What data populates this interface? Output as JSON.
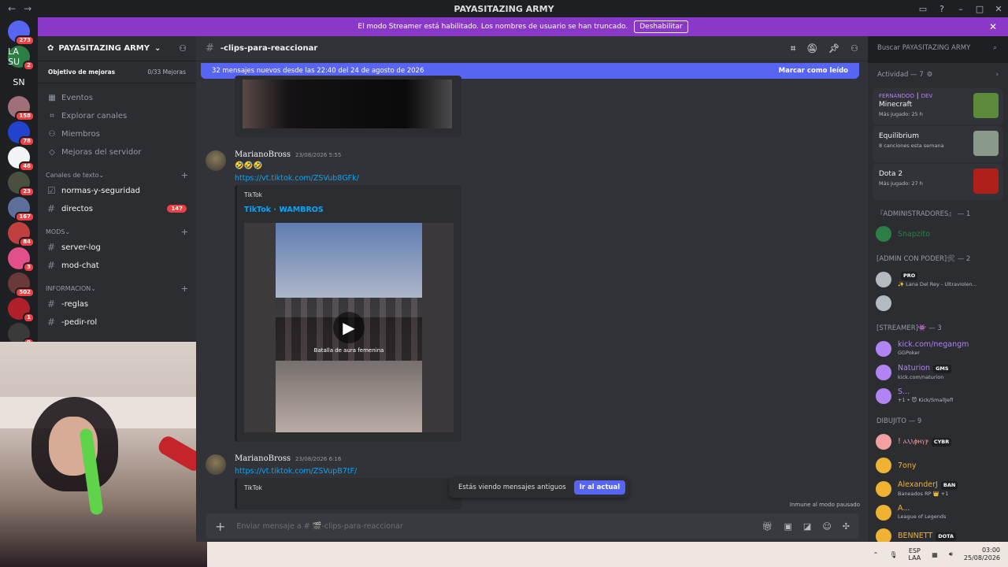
{
  "window": {
    "title": "PAYASITAZING ARMY"
  },
  "banner": {
    "text": "El modo Streamer está habilitado. Los nombres de usuario se han truncado.",
    "button": "Deshabilitar"
  },
  "servers": [
    {
      "label": "",
      "badge": "273",
      "color": "#5865f2"
    },
    {
      "label": "LA SU",
      "badge": "2",
      "color": "#2d7d46"
    },
    {
      "label": "SN",
      "badge": "",
      "color": "#1e1f22"
    },
    {
      "label": "",
      "badge": "158",
      "color": "#a0707a"
    },
    {
      "label": "",
      "badge": "78",
      "color": "#2244cc"
    },
    {
      "label": "",
      "badge": "46",
      "color": "#f2f3f5"
    },
    {
      "label": "",
      "badge": "23",
      "color": "#4a5040"
    },
    {
      "label": "",
      "badge": "167",
      "color": "#5b6f9a"
    },
    {
      "label": "",
      "badge": "84",
      "color": "#c04040"
    },
    {
      "label": "",
      "badge": "3",
      "color": "#e2508a"
    },
    {
      "label": "",
      "badge": "502",
      "color": "#6a3a3a"
    },
    {
      "label": "",
      "badge": "1",
      "color": "#b0202a"
    },
    {
      "label": "",
      "badge": "9",
      "color": "#3a3a3a"
    }
  ],
  "sidebar": {
    "server_name": "PAYASITAZING ARMY",
    "goal": {
      "label": "Objetivo de mejoras",
      "count": "0/33 Mejoras"
    },
    "menu": [
      "Eventos",
      "Explorar canales",
      "Miembros",
      "Mejoras del servidor"
    ],
    "categories": [
      {
        "name": "Canales de texto",
        "channels": [
          {
            "name": "normas-y-seguridad",
            "badge": "",
            "icon": "rules-icon"
          },
          {
            "name": "directos",
            "badge": "147",
            "icon": "hash-icon"
          }
        ]
      },
      {
        "name": "MODS",
        "channels": [
          {
            "name": "server-log",
            "badge": "",
            "icon": "hash-icon"
          },
          {
            "name": "mod-chat",
            "badge": "",
            "icon": "hash-icon"
          }
        ]
      },
      {
        "name": "INFORMACION",
        "channels": [
          {
            "name": "-reglas",
            "badge": "",
            "icon": "hash-icon"
          },
          {
            "name": "-pedir-rol",
            "badge": "",
            "icon": "hash-icon"
          }
        ]
      }
    ]
  },
  "chat": {
    "channel": "-clips-para-reaccionar",
    "newbar": {
      "text": "32 mensajes nuevos desde las 22:40 del 24 de agosto de 2026",
      "action": "Marcar como leído"
    },
    "messages": [
      {
        "author": "MarianoBross",
        "time": "23/08/2026 5:55",
        "emoji": "🤣🤣🤣",
        "link": "https://vt.tiktok.com/ZSVub8GFk/",
        "provider": "TikTok",
        "embed_title": "TikTok · WAMBROS",
        "caption": "Batalla de aura femenina"
      },
      {
        "author": "MarianoBross",
        "time": "23/08/2026 6:16",
        "link": "https://vt.tiktok.com/ZSVupB7tF/",
        "provider": "TikTok"
      }
    ],
    "toast": {
      "text": "Estás viendo mensajes antiguos",
      "button": "Ir al actual"
    },
    "immune": "Inmune al modo pausado",
    "composer_placeholder": "Enviar mensaje a # 🎬-clips-para-reaccionar"
  },
  "search": {
    "placeholder": "Buscar PAYASITAZING ARMY"
  },
  "members": {
    "activity_header": "Actividad — 7",
    "activities": [
      {
        "who": "FERNANDOO ┃ DEV",
        "game": "Minecraft",
        "sub": "Más jugado: 25 h",
        "art": "#5a8a3a"
      },
      {
        "who": "",
        "game": "Equilibrium",
        "sub": "8 canciones esta semana",
        "art": "#8a9a8a"
      },
      {
        "who": "",
        "game": "Dota 2",
        "sub": "Más jugado: 27 h",
        "art": "#b0201a"
      }
    ],
    "groups": [
      {
        "title": "『ADMINISTRADORES』 — 1",
        "members": [
          {
            "name": "Snapzito",
            "status": "",
            "color": "#2d7d46",
            "tag": ""
          }
        ]
      },
      {
        "title": "[ADMIN CON PODER]🛠 — 2",
        "members": [
          {
            "name": "",
            "status": "✨ Lana Del Rey - Ultraviolen...",
            "color": "#b5bac1",
            "tag": "PRO"
          },
          {
            "name": "",
            "status": "",
            "color": "#b5bac1",
            "tag": ""
          }
        ]
      },
      {
        "title": "[STREAMER]👾 — 3",
        "members": [
          {
            "name": "kick.com/negangm",
            "status": "GGPoker",
            "color": "#b084f2",
            "tag": ""
          },
          {
            "name": "Naturion",
            "status": "kick.com/naturion",
            "color": "#b084f2",
            "tag": "GMS"
          },
          {
            "name": "S...",
            "status": "+1 • 😈 Kick/SmallJeff",
            "color": "#b084f2",
            "tag": ""
          }
        ]
      },
      {
        "title": "DIBUJITO — 9",
        "members": [
          {
            "name": "! ⲁⲗⲗⲫⲏⲩⲣ",
            "status": "",
            "color": "#f2a0a0",
            "tag": "CYBR"
          },
          {
            "name": "7ony",
            "status": "",
            "color": "#f0b232",
            "tag": ""
          },
          {
            "name": "AlexanderJ",
            "status": "Baneados RP 👑 +1",
            "color": "#f0b232",
            "tag": "BAN"
          },
          {
            "name": "A...",
            "status": "League of Legends",
            "color": "#f0b232",
            "tag": ""
          },
          {
            "name": "BENNETT",
            "status": "",
            "color": "#f0b232",
            "tag": "DOTA"
          }
        ]
      }
    ]
  },
  "taskbar": {
    "lang1": "ESP",
    "lang2": "LAA",
    "time": "03:00",
    "date": "25/08/2026"
  }
}
